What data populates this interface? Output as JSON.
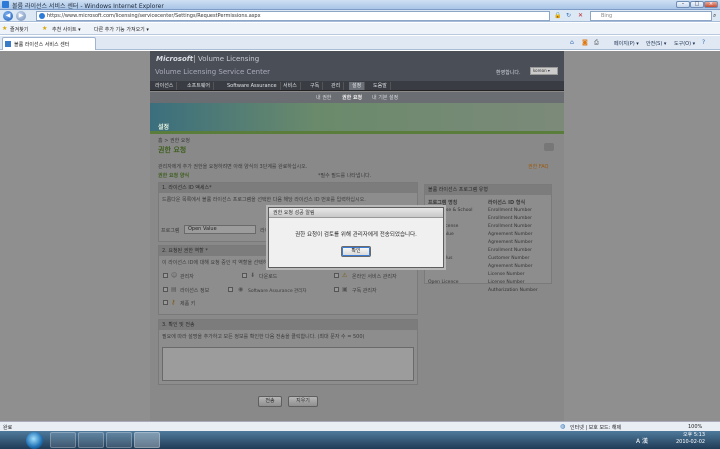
{
  "window": {
    "title": "볼륨 라이선스 서비스 센터 - Windows Internet Explorer"
  },
  "addressbar": {
    "url": "https://www.microsoft.com/licensing/servicecenter/Settings/RequestPermissions.aspx",
    "search_placeholder": "Bing"
  },
  "favbar": {
    "favorites": "즐겨찾기",
    "suggested": "추천 사이트 ▾",
    "addons": "다른 추가 기능 가져오기 ▾"
  },
  "tabbar": {
    "tab": "볼륨 라이선스 서비스 센터",
    "page": "페이지(P) ▾",
    "safety": "안전(S) ▾",
    "tools": "도구(O) ▾"
  },
  "header": {
    "brand": "Microsoft",
    "product": "Volume Licensing",
    "subtitle": "Volume Licensing Service Center",
    "welcome": "환영합니다.",
    "lang": "korean ▾"
  },
  "menu": [
    "라이선스",
    "소프트웨어",
    "Software Assurance",
    "서비스",
    "구독",
    "관리",
    "설정",
    "도움말"
  ],
  "submenu": [
    "내 권한",
    "권한 요청",
    "내 기본 설정"
  ],
  "banner": {
    "title": "설정"
  },
  "body": {
    "breadcrumb": "홈 > 권한 요청",
    "title": "권한 요청",
    "faq": "권한 FAQ",
    "intro": "관리자에게 추가 권한을 요청하려면 아래 양식의 3단계를 완료하십시오.",
    "required": "*필수 필드를 나타냅니다.",
    "form_title": "권한 요청 양식",
    "step1": {
      "title": "1. 라이선스 ID 액세스*",
      "desc": "드롭다운 목록에서 볼륨 라이선스 프로그램을 선택한 다음 해당 라이선스 ID 번호를 입력하십시오.",
      "program_label": "프로그램",
      "program_value": "Open Value",
      "id_label": "라이선스"
    },
    "step2": {
      "title": "2. 요청된 권한 역할 *",
      "desc": "이 라이선스 ID에 대해 요청 중인 각 역할을 선택하십시오.",
      "roles": [
        "관리자",
        "다운로드",
        "온라인 서비스 관리자",
        "라이선스 정보",
        "Software Assurance 관리자",
        "구독 관리자",
        "제품 키"
      ]
    },
    "step3": {
      "title": "3. 확인 및 전송",
      "desc": "필요에 따라 설명을 추가하고 모든 정보를 확인한 다음 전송을 클릭합니다. (최대 문자 수 = 500)"
    },
    "submit": "전송",
    "clear": "지우기"
  },
  "sidepanel": {
    "title": "볼륨 라이선스 프로그램 유형",
    "col1": "프로그램 명칭",
    "col2": "라이선스 ID 형식",
    "rows": [
      [
        "Enterprise & School",
        "Enrollment Number"
      ],
      [
        "Select",
        "Enrollment Number"
      ],
      [
        "Open License",
        "Enrollment Number"
      ],
      [
        "Open Value",
        "Agreement Number"
      ],
      [
        "",
        "Agreement Number"
      ],
      [
        "",
        "Enrollment Number"
      ],
      [
        "Select Plus",
        "Customer Number"
      ],
      [
        "Campus",
        "Agreement Number"
      ],
      [
        "",
        "License Number"
      ],
      [
        "Open Licence",
        "License Number"
      ],
      [
        "",
        "Authorization Number"
      ]
    ]
  },
  "dialog": {
    "title": "권한 요청 성공 알림",
    "message": "권한 요청이 검토를 위해 관리자에게 전송되었습니다.",
    "ok": "확인"
  },
  "statusbar": {
    "done": "완료",
    "zone": "인터넷 | 보호 모드: 해제",
    "zoom": "100%"
  },
  "taskbar": {
    "lang": "A 漢",
    "time": "오후 5:13",
    "date": "2010-02-02"
  }
}
